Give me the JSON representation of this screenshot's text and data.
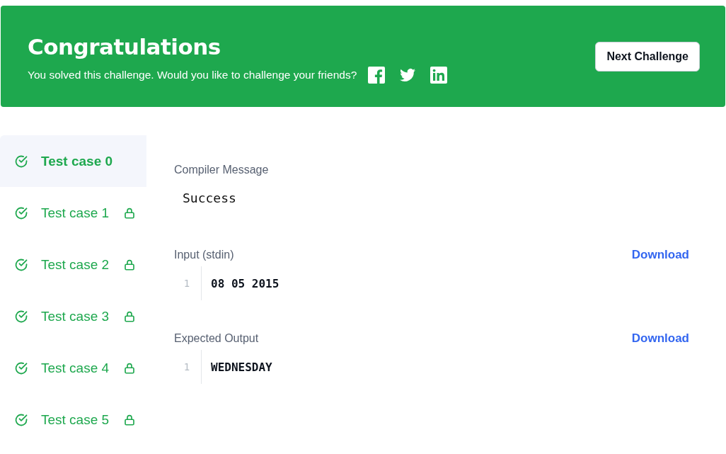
{
  "banner": {
    "title": "Congratulations",
    "message": "You solved this challenge. Would you like to challenge your friends?",
    "share_icons": [
      {
        "kind": "facebook"
      },
      {
        "kind": "twitter"
      },
      {
        "kind": "linkedin"
      }
    ],
    "button": "Next Challenge"
  },
  "test_cases": [
    {
      "label": "Test case 0",
      "passed": true,
      "locked": false,
      "selected": true
    },
    {
      "label": "Test case 1",
      "passed": true,
      "locked": true,
      "selected": false
    },
    {
      "label": "Test case 2",
      "passed": true,
      "locked": true,
      "selected": false
    },
    {
      "label": "Test case 3",
      "passed": true,
      "locked": true,
      "selected": false
    },
    {
      "label": "Test case 4",
      "passed": true,
      "locked": true,
      "selected": false
    },
    {
      "label": "Test case 5",
      "passed": true,
      "locked": true,
      "selected": false
    }
  ],
  "sections": [
    {
      "kind": "message",
      "title": "Compiler Message",
      "text": "Success"
    },
    {
      "kind": "code",
      "title": "Input (stdin)",
      "link": "Download",
      "lines": [
        {
          "number": "1",
          "text": "08 05 2015"
        }
      ]
    },
    {
      "kind": "code",
      "title": "Expected Output",
      "link": "Download",
      "lines": [
        {
          "number": "1",
          "text": "WEDNESDAY"
        }
      ]
    }
  ]
}
